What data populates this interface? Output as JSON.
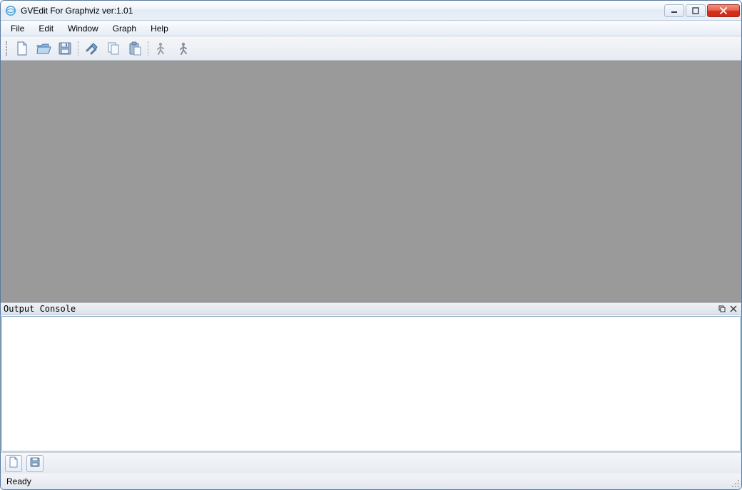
{
  "window": {
    "title": "GVEdit For Graphviz ver:1.01"
  },
  "menubar": {
    "items": [
      "File",
      "Edit",
      "Window",
      "Graph",
      "Help"
    ]
  },
  "toolbar": {
    "icons": {
      "new": "new-file-icon",
      "open": "open-folder-icon",
      "save": "save-icon",
      "settings": "settings-icon",
      "copy": "copy-icon",
      "paste": "paste-icon",
      "run": "run-icon",
      "run_all": "run-all-icon"
    }
  },
  "dock": {
    "title": "Output Console"
  },
  "console": {
    "text": ""
  },
  "statusbar": {
    "text": "Ready"
  }
}
